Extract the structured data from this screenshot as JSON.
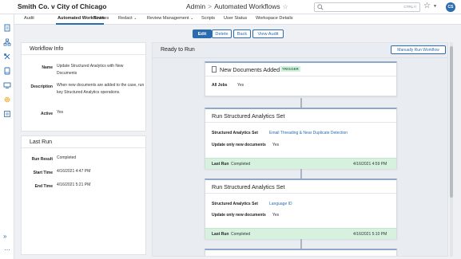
{
  "header": {
    "case_title": "Smith Co. v City of Chicago",
    "breadcrumb_root": "Admin",
    "breadcrumb_sep": ">",
    "page_title": "Automated Workflows",
    "search_placeholder": "",
    "search_shortcut": "CTRL+/",
    "user_initials": "CS"
  },
  "tabs": [
    {
      "label": "Audit"
    },
    {
      "label": "Automated Workflows",
      "active": true
    },
    {
      "label": "Entities"
    },
    {
      "label": "Redact",
      "dropdown": true
    },
    {
      "label": "Review Management",
      "dropdown": true
    },
    {
      "label": "Scripts"
    },
    {
      "label": "User Status"
    },
    {
      "label": "Workspace Details"
    }
  ],
  "tab_labels": {
    "audit": "Audit",
    "automated_workflows": "Automated Workflows",
    "entities": "Entities",
    "redact": "Redact",
    "review_management": "Review Management",
    "scripts": "Scripts",
    "user_status": "User Status",
    "workspace_details": "Workspace Details"
  },
  "actions": {
    "edit": "Edit",
    "delete": "Delete",
    "back": "Back",
    "view_audit": "View Audit"
  },
  "workflow_info": {
    "title": "Workflow Info",
    "name_label": "Name",
    "name_value": "Update Structured Analytics with New Documents",
    "description_label": "Description",
    "description_value": "When new documents are added to the case, run key Structured Analytics operations.",
    "active_label": "Active",
    "active_value": "Yes"
  },
  "last_run_panel": {
    "title": "Last Run",
    "run_result_label": "Run Result",
    "run_result_value": "Completed",
    "start_time_label": "Start Time",
    "start_time_value": "4/16/2021 4:47 PM",
    "end_time_label": "End Time",
    "end_time_value": "4/16/2021 5:21 PM"
  },
  "flow": {
    "status": "Ready to Run",
    "manual_run_label": "Manually Run Workflow",
    "trigger_card": {
      "title": "New Documents Added",
      "badge": "TRIGGER",
      "jobs_label": "All Jobs",
      "jobs_value": "Yes"
    },
    "action_cards": [
      {
        "title": "Run Structured Analytics Set",
        "set_label": "Structured Analytics Set",
        "set_value": "Email Threading & Near Duplicate Detection",
        "update_label": "Update only new documents",
        "update_value": "Yes",
        "lastrun_label": "Last Run",
        "lastrun_status": "Completed",
        "lastrun_time": "4/16/2021 4:59 PM"
      },
      {
        "title": "Run Structured Analytics Set",
        "set_label": "Structured Analytics Set",
        "set_value": "Language ID",
        "update_label": "Update only new documents",
        "update_value": "Yes",
        "lastrun_label": "Last Run",
        "lastrun_status": "Completed",
        "lastrun_time": "4/16/2021 5:10 PM"
      }
    ]
  },
  "colors": {
    "accent": "#2b6cb0",
    "success_bg": "#d6f2df",
    "badge_text": "#2e7d4f"
  },
  "icons": {
    "sidebar": [
      "document-icon",
      "hierarchy-icon",
      "tools-icon",
      "book-icon",
      "monitor-icon",
      "gear-icon",
      "list-icon"
    ],
    "expand": "double-chevron-right-icon",
    "more": "ellipsis-icon",
    "search": "search-icon",
    "favorite": "star-icon",
    "trigger": "document-icon"
  }
}
